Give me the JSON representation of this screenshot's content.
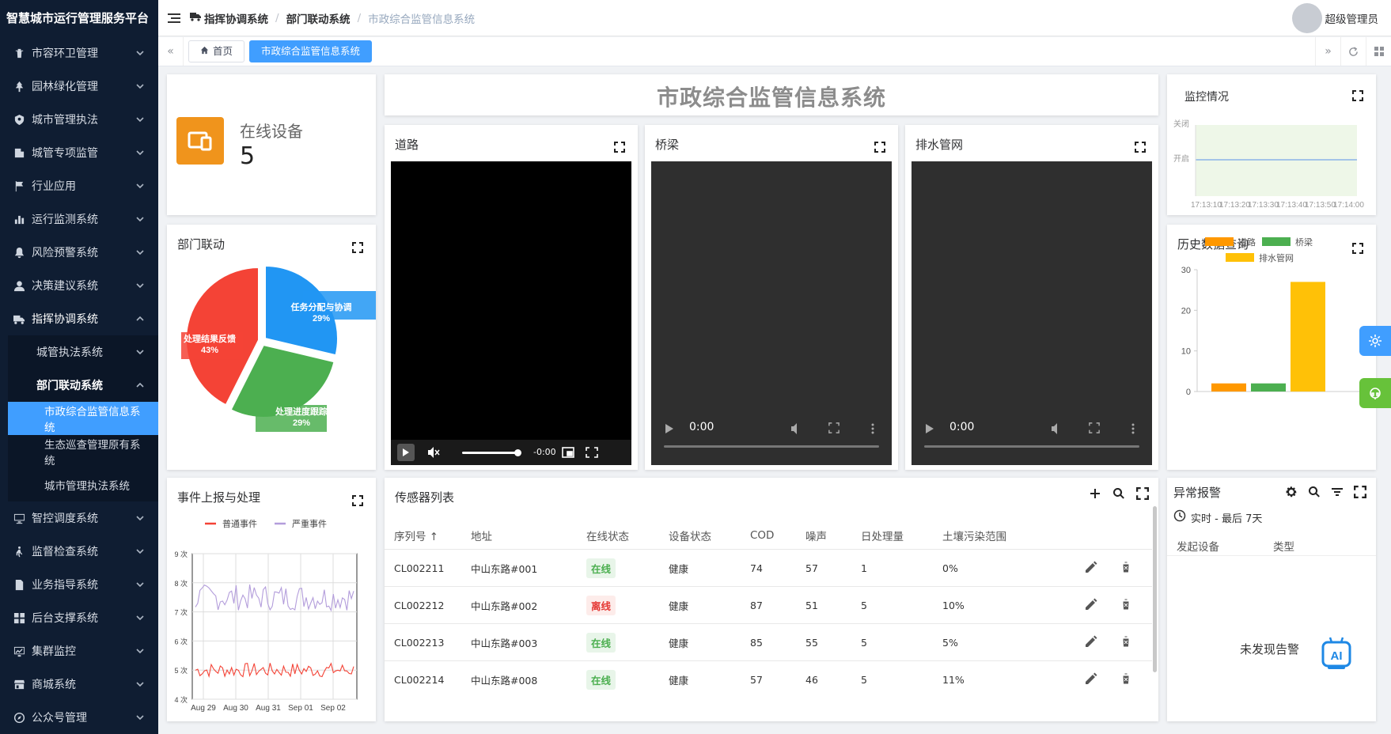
{
  "app": {
    "brand": "智慧城市运行管理服务平台"
  },
  "sidebar": {
    "items": [
      {
        "label": "市容环卫管理",
        "icon": "trash-icon"
      },
      {
        "label": "园林绿化管理",
        "icon": "tree-icon"
      },
      {
        "label": "城市管理执法",
        "icon": "badge-icon"
      },
      {
        "label": "城管专项监管",
        "icon": "building-icon"
      },
      {
        "label": "行业应用",
        "icon": "flag-icon"
      },
      {
        "label": "运行监测系统",
        "icon": "bar-chart-icon"
      },
      {
        "label": "风险预警系统",
        "icon": "bell-icon"
      },
      {
        "label": "决策建议系统",
        "icon": "person-icon"
      },
      {
        "label": "指挥协调系统",
        "icon": "truck-icon"
      }
    ],
    "sub_items": [
      {
        "label": "城管执法系统"
      },
      {
        "label": "部门联动系统"
      }
    ],
    "subsub_items": [
      {
        "label": "市政综合监管信息系统"
      },
      {
        "label": "生态巡查管理原有系统"
      },
      {
        "label": "城市管理执法系统"
      }
    ],
    "bottom_items": [
      {
        "label": "智控调度系统",
        "icon": "monitor-icon"
      },
      {
        "label": "监督检查系统",
        "icon": "walker-icon"
      },
      {
        "label": "业务指导系统",
        "icon": "document-icon"
      },
      {
        "label": "后台支撑系统",
        "icon": "grid-icon"
      },
      {
        "label": "集群监控",
        "icon": "screen-chart-icon"
      },
      {
        "label": "商城系统",
        "icon": "shop-icon"
      },
      {
        "label": "公众号管理",
        "icon": "compass-icon"
      }
    ]
  },
  "header": {
    "breadcrumb": [
      "指挥协调系统",
      "部门联动系统",
      "市政综合监管信息系统"
    ],
    "username": "超级管理员"
  },
  "tags": {
    "home": "首页",
    "active": "市政综合监管信息系统"
  },
  "online": {
    "label": "在线设备",
    "value": "5"
  },
  "system_title": "市政综合监管信息系统",
  "videos": [
    {
      "title": "道路",
      "time": "-0:00"
    },
    {
      "title": "桥梁",
      "time": "0:00"
    },
    {
      "title": "排水管网",
      "time": "0:00"
    }
  ],
  "monitor": {
    "title": "监控情况",
    "y_labels": [
      "关闭",
      "开启"
    ],
    "x_labels": [
      "17:13:10",
      "17:13:20",
      "17:13:30",
      "17:13:40",
      "17:13:50",
      "17:14:00"
    ]
  },
  "history": {
    "title": "历史数据查询",
    "legend": [
      "道路",
      "桥梁",
      "排水管网"
    ],
    "y_ticks": [
      "30",
      "20",
      "10",
      "0"
    ]
  },
  "dept": {
    "title": "部门联动",
    "slices": [
      {
        "name": "任务分配与协调",
        "pct": "29%"
      },
      {
        "name": "处理进度跟踪",
        "pct": "29%"
      },
      {
        "name": "处理结果反馈",
        "pct": "43%"
      }
    ]
  },
  "events": {
    "title": "事件上报与处理",
    "legend": [
      "普通事件",
      "严重事件"
    ],
    "y_ticks": [
      "9 次",
      "8 次",
      "7 次",
      "6 次",
      "5 次",
      "4 次"
    ],
    "x_ticks": [
      "Aug 29",
      "Aug 30",
      "Aug 31",
      "Sep 01",
      "Sep 02"
    ]
  },
  "sensors": {
    "title": "传感器列表",
    "headers": [
      "序列号",
      "地址",
      "在线状态",
      "设备状态",
      "COD",
      "噪声",
      "日处理量",
      "土壤污染范围"
    ],
    "rows": [
      {
        "id": "CL002211",
        "addr": "中山东路#001",
        "online": "在线",
        "dev": "健康",
        "cod": "74",
        "noise": "57",
        "daily": "1",
        "soil": "0%"
      },
      {
        "id": "CL002212",
        "addr": "中山东路#002",
        "online": "离线",
        "dev": "健康",
        "cod": "87",
        "noise": "51",
        "daily": "5",
        "soil": "10%"
      },
      {
        "id": "CL002213",
        "addr": "中山东路#003",
        "online": "在线",
        "dev": "健康",
        "cod": "85",
        "noise": "55",
        "daily": "5",
        "soil": "5%"
      },
      {
        "id": "CL002214",
        "addr": "中山东路#008",
        "online": "在线",
        "dev": "健康",
        "cod": "57",
        "noise": "46",
        "daily": "5",
        "soil": "11%"
      }
    ]
  },
  "alarm": {
    "title": "异常报警",
    "range": "实时 - 最后 7天",
    "headers": [
      "发起设备",
      "类型"
    ],
    "empty": "未发现告警"
  },
  "chart_data": [
    {
      "type": "pie",
      "categories": [
        "任务分配与协调",
        "处理进度跟踪",
        "处理结果反馈"
      ],
      "values": [
        29,
        29,
        43
      ],
      "colors": [
        "#2196f3",
        "#4caf50",
        "#f44336"
      ]
    },
    {
      "type": "bar",
      "title": "历史数据查询",
      "categories": [
        "道路",
        "桥梁",
        "排水管网"
      ],
      "values": [
        2,
        2,
        27
      ],
      "colors": [
        "#ff9800",
        "#4caf50",
        "#ffc107"
      ],
      "ylim": [
        0,
        30
      ]
    },
    {
      "type": "line",
      "x": [
        "Aug 29",
        "Aug 30",
        "Aug 31",
        "Sep 01",
        "Sep 02"
      ],
      "series": [
        {
          "name": "普通事件",
          "color": "#f44336",
          "level": 5
        },
        {
          "name": "严重事件",
          "color": "#b39ddb",
          "level": 7.5
        }
      ],
      "ylim": [
        4,
        9
      ]
    }
  ]
}
